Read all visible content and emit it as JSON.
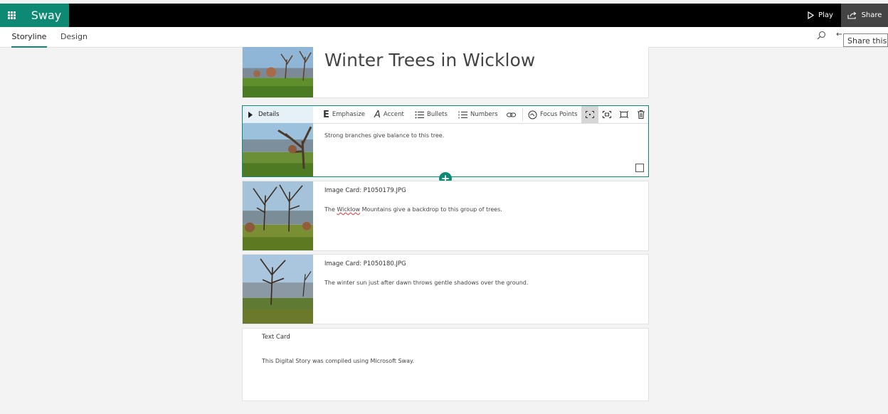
{
  "app": {
    "name": "Sway"
  },
  "topbar": {
    "play_label": "Play",
    "share_label": "Share"
  },
  "tabs": [
    {
      "label": "Storyline",
      "active": true
    },
    {
      "label": "Design",
      "active": false
    }
  ],
  "tooltip": {
    "text": "Share this Sway"
  },
  "cards": {
    "title_card": {
      "title": "Winter Trees in Wicklow"
    },
    "selected_card": {
      "details_label": "Details",
      "toolbar": {
        "emphasize": "Emphasize",
        "accent": "Accent",
        "bullets": "Bullets",
        "numbers": "Numbers",
        "focus_points": "Focus Points"
      },
      "body": "Strong branches give balance to this tree."
    },
    "image_card_1": {
      "title": "Image Card: P1050179.JPG",
      "body_before": "The ",
      "body_flagged": "Wicklow",
      "body_after": " Mountains give a backdrop to this group of trees."
    },
    "image_card_2": {
      "title": "Image Card: P1050180.JPG",
      "body": "The winter sun just after dawn throws gentle shadows over the ground."
    },
    "text_card": {
      "title": "Text Card",
      "body": "This Digital Story was compiled using Microsoft Sway."
    }
  },
  "colors": {
    "accent": "#0e8a74",
    "topbar": "#000000"
  },
  "icons": [
    "waffle-icon",
    "play-icon",
    "share-icon",
    "search-icon",
    "undo-icon",
    "caret-right-icon",
    "link-icon",
    "focus-icon",
    "frame-icon",
    "delete-icon",
    "add-icon"
  ]
}
